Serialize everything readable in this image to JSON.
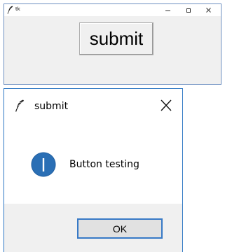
{
  "main_window": {
    "title": "tk",
    "icon": "feather-icon",
    "controls": {
      "minimize_icon": "minimize-icon",
      "maximize_icon": "maximize-icon",
      "close_icon": "close-icon"
    },
    "submit_button_label": "submit"
  },
  "dialog": {
    "title": "submit",
    "icon": "feather-icon",
    "close_icon": "close-icon",
    "message_icon": "info-icon",
    "message": "Button testing",
    "ok_button_label": "OK"
  },
  "colors": {
    "window_border": "#6d8fc0",
    "dialog_border": "#2f78c4",
    "info_icon_fill": "#2a6fb5",
    "ok_button_border": "#3779c6",
    "client_background": "#f0f0f0"
  }
}
